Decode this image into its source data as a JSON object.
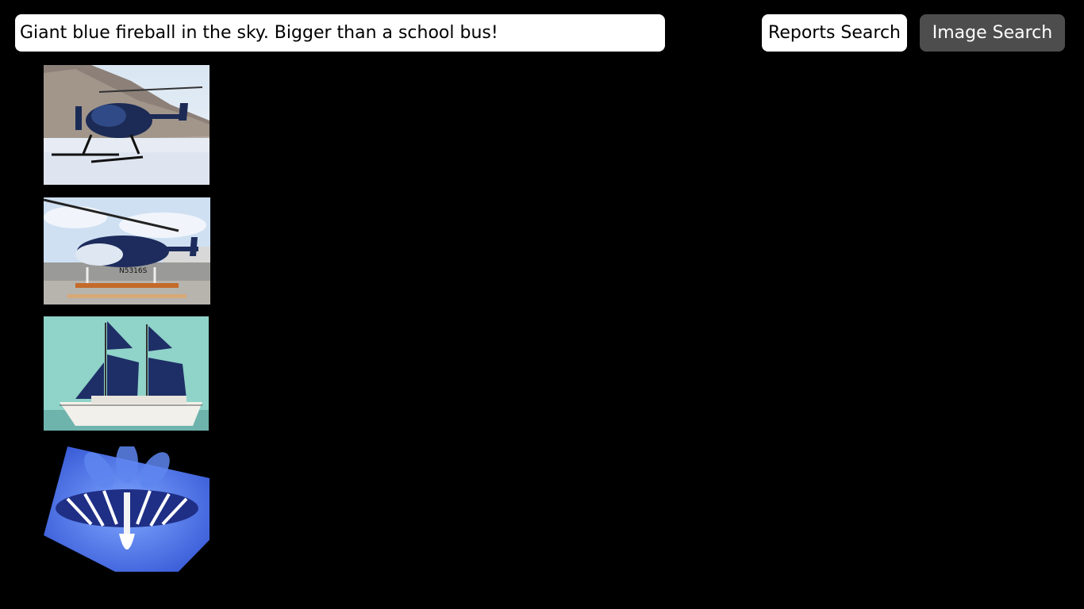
{
  "search": {
    "value": "Giant blue fireball in the sky. Bigger than a school bus!"
  },
  "buttons": {
    "reports_search": "Reports Search",
    "image_search": "Image Search"
  },
  "results": [
    {
      "icon": "helicopter-on-snow-image"
    },
    {
      "icon": "helicopter-on-trailer-image"
    },
    {
      "icon": "sailing-ship-image"
    },
    {
      "icon": "butterfly-on-flower-image"
    }
  ],
  "colors": {
    "background": "#000000",
    "reports_button_bg": "#ffffff",
    "image_button_bg": "#4d4d4d"
  }
}
